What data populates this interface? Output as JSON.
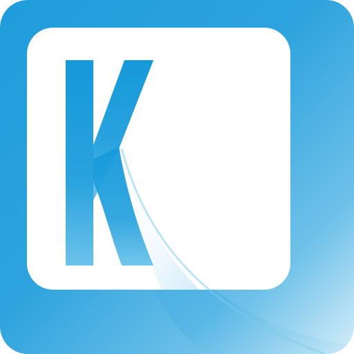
{
  "icon": {
    "name": "k-letter-app-icon",
    "logo_lettering": "K",
    "colors": {
      "tile_top": "#1f9ddc",
      "tile_bottom": "#c9e9f7",
      "key_face": "#ffffff",
      "letter_top": "#1599d9",
      "letter_bottom": "#5cbbe6",
      "swoosh": "#45ade2"
    }
  }
}
